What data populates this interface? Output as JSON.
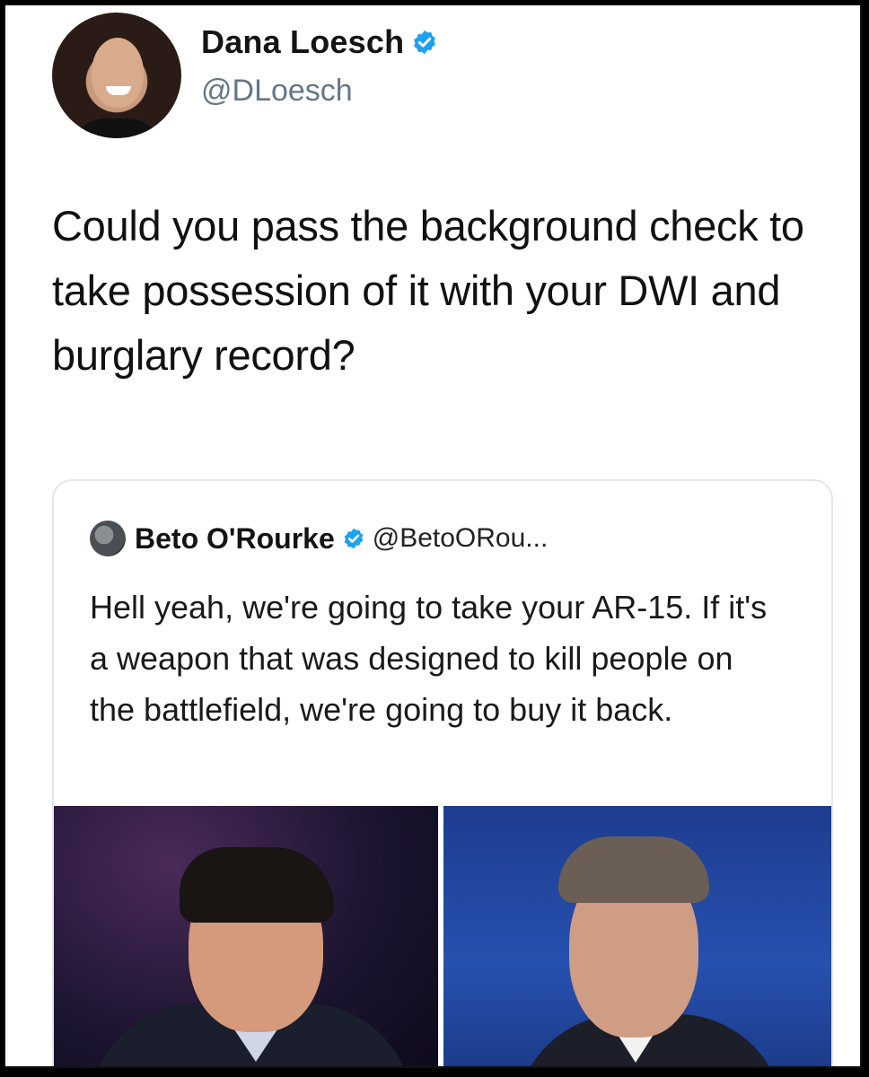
{
  "tweet": {
    "author": {
      "display_name": "Dana Loesch",
      "handle": "@DLoesch",
      "verified": true
    },
    "text": "Could you pass the background check to take possession of it with your DWI and burglary record?"
  },
  "quoted_tweet": {
    "author": {
      "display_name": "Beto O'Rourke",
      "handle": "@BetoORou...",
      "verified": true
    },
    "text": "Hell yeah, we're going to take your AR-15. If it's a weapon that was designed to kill people on the battlefield, we're going to buy it back.",
    "media": [
      "debate-photo-moderator",
      "debate-photo-candidate"
    ]
  },
  "colors": {
    "verified_blue": "#1DA1F2",
    "handle_gray": "#657786",
    "card_border": "#E4E7EA"
  }
}
